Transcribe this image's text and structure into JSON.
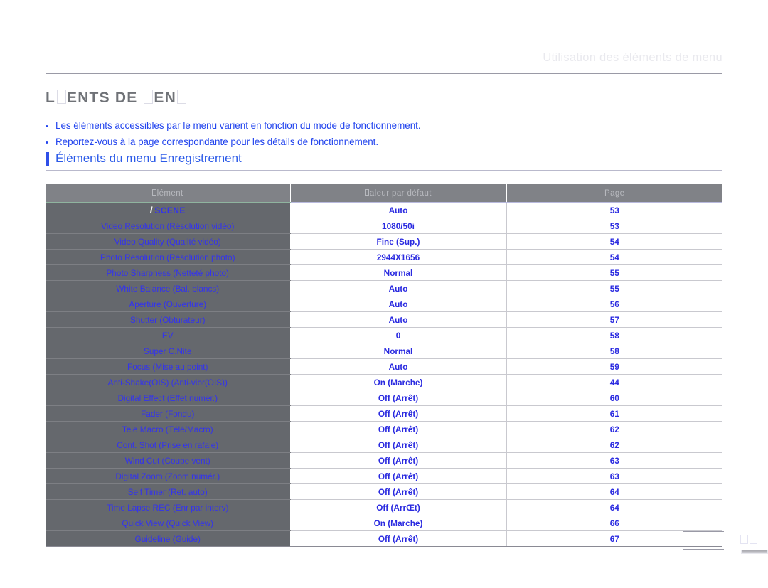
{
  "running_head": "Utilisation des éléments de menu",
  "page_title": {
    "segments": [
      "L",
      "TOFU",
      " ENTS DE ",
      "TOFU",
      "EN",
      "TOFU"
    ],
    "plain": "L□ENTS DE □EN□"
  },
  "bullets": [
    "Les éléments accessibles par le menu varient en fonction du mode de fonctionnement.",
    "Reportez-vous à la page correspondante pour les détails de fonctionnement."
  ],
  "section": {
    "title": "Éléments du menu Enregistrement",
    "accent_color": "#2f4fe8"
  },
  "table": {
    "headers": {
      "item": "lément",
      "value": "aleur par défaut",
      "page": "Page"
    },
    "rows": [
      {
        "item": "iSCENE",
        "is_iscene": true,
        "value": "Auto",
        "page": "53"
      },
      {
        "item": "Video Resolution (Résolution vidéo)",
        "is_iscene": false,
        "value": "1080/50i",
        "page": "53"
      },
      {
        "item": "Video Quality (Qualité vidéo)",
        "is_iscene": false,
        "value": "Fine (Sup.)",
        "page": "54"
      },
      {
        "item": "Photo Resolution (Résolution photo)",
        "is_iscene": false,
        "value": "2944X1656",
        "page": "54"
      },
      {
        "item": "Photo Sharpness (Netteté photo)",
        "is_iscene": false,
        "value": "Normal",
        "page": "55"
      },
      {
        "item": "White Balance (Bal. blancs)",
        "is_iscene": false,
        "value": "Auto",
        "page": "55"
      },
      {
        "item": "Aperture (Ouverture)",
        "is_iscene": false,
        "value": "Auto",
        "page": "56"
      },
      {
        "item": "Shutter (Obturateur)",
        "is_iscene": false,
        "value": "Auto",
        "page": "57"
      },
      {
        "item": "EV",
        "is_iscene": false,
        "value": "0",
        "page": "58"
      },
      {
        "item": "Super C.Nite",
        "is_iscene": false,
        "value": "Normal",
        "page": "58"
      },
      {
        "item": "Focus (Mise au point)",
        "is_iscene": false,
        "value": "Auto",
        "page": "59"
      },
      {
        "item": "Anti-Shake(OIS) (Anti-vibr(OIS))",
        "is_iscene": false,
        "value": "On (Marche)",
        "page": "44"
      },
      {
        "item": "Digital Effect (Effet numér.)",
        "is_iscene": false,
        "value": "Off (Arrêt)",
        "page": "60"
      },
      {
        "item": "Fader (Fondu)",
        "is_iscene": false,
        "value": "Off (Arrêt)",
        "page": "61"
      },
      {
        "item": "Tele Macro (Télé/Macro)",
        "is_iscene": false,
        "value": "Off (Arrêt)",
        "page": "62"
      },
      {
        "item": "Cont. Shot (Prise en rafale)",
        "is_iscene": false,
        "value": "Off (Arrêt)",
        "page": "62"
      },
      {
        "item": "Wind Cut (Coupe vent)",
        "is_iscene": false,
        "value": "Off (Arrêt)",
        "page": "63"
      },
      {
        "item": "Digital Zoom (Zoom numér.)",
        "is_iscene": false,
        "value": "Off (Arrêt)",
        "page": "63"
      },
      {
        "item": "Self Timer (Ret. auto)",
        "is_iscene": false,
        "value": "Off (Arrêt)",
        "page": "64"
      },
      {
        "item": "Time Lapse REC (Enr par interv)",
        "is_iscene": false,
        "value": "Off (ArrŒt)",
        "page": "64"
      },
      {
        "item": "Quick View (Quick View)",
        "is_iscene": false,
        "value": "On (Marche)",
        "page": "66"
      },
      {
        "item": "Guideline (Guide)",
        "is_iscene": false,
        "value": "Off (Arrêt)",
        "page": "67"
      }
    ]
  },
  "iscene_label": {
    "prefix": "i",
    "text": "SCENE"
  },
  "colors": {
    "link_blue": "#2244ee",
    "header_gray": "#808287",
    "row_gray": "#65686d",
    "running_head_gray": "#e9e9ee"
  }
}
